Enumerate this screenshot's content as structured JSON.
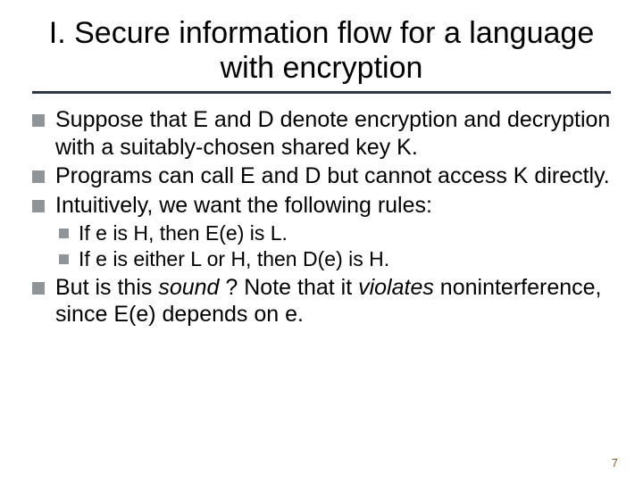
{
  "title": "I. Secure information flow for a language with encryption",
  "bullets": [
    {
      "segments": [
        {
          "t": "Suppose that "
        },
        {
          "t": "E",
          "cls": "mono"
        },
        {
          "t": " and "
        },
        {
          "t": "D",
          "cls": "mono"
        },
        {
          "t": " denote encryption and decryption with a suitably-chosen shared key K."
        }
      ]
    },
    {
      "segments": [
        {
          "t": "Programs can call "
        },
        {
          "t": "E",
          "cls": "mono"
        },
        {
          "t": " and "
        },
        {
          "t": "D",
          "cls": "mono"
        },
        {
          "t": " but cannot access K directly."
        }
      ]
    },
    {
      "segments": [
        {
          "t": "Intuitively, we want the following rules:"
        }
      ],
      "children": [
        {
          "segments": [
            {
              "t": "If e is H, then "
            },
            {
              "t": "E",
              "cls": "mono"
            },
            {
              "t": "(e) is L."
            }
          ]
        },
        {
          "segments": [
            {
              "t": "If e is either L or H, then "
            },
            {
              "t": "D",
              "cls": "mono"
            },
            {
              "t": "(e) is H."
            }
          ]
        }
      ]
    },
    {
      "segments": [
        {
          "t": "But is this "
        },
        {
          "t": "sound",
          "cls": "italic"
        },
        {
          "t": " ?  Note that it "
        },
        {
          "t": "violates",
          "cls": "italic"
        },
        {
          "t": " noninterference, since "
        },
        {
          "t": "E",
          "cls": "mono"
        },
        {
          "t": "(e) depends on e."
        }
      ]
    }
  ],
  "pageNumber": "7"
}
